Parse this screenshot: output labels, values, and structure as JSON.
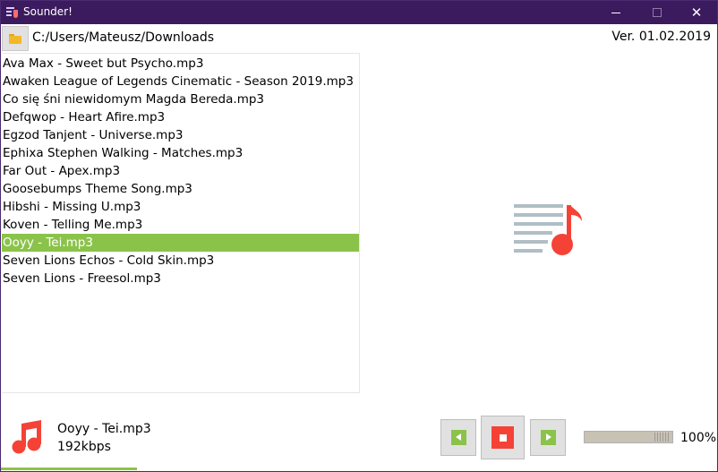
{
  "window": {
    "title": "Sounder!"
  },
  "toolbar": {
    "path": "C:/Users/Mateusz/Downloads",
    "version": "Ver. 01.02.2019"
  },
  "files": [
    "Ava Max - Sweet but Psycho.mp3",
    "Awaken  League of Legends Cinematic - Season 2019.mp3",
    "Co się śni niewidomym Magda Bereda.mp3",
    "Defqwop - Heart Afire.mp3",
    "Egzod  Tanjent - Universe.mp3",
    "Ephixa  Stephen Walking - Matches.mp3",
    "Far Out - Apex.mp3",
    "Goosebumps Theme Song.mp3",
    "Hibshi - Missing U.mp3",
    "Koven - Telling Me.mp3",
    "Ooyy - Tei.mp3",
    "Seven Lions  Echos - Cold Skin.mp3",
    "Seven Lions - Freesol.mp3"
  ],
  "selected_index": 10,
  "now_playing": {
    "title": "Ooyy - Tei.mp3",
    "bitrate": "192kbps",
    "progress": 0.38
  },
  "volume": {
    "label": "100%",
    "value": 1.0
  },
  "icons": {
    "folder": "folder-icon",
    "prev": "previous-icon",
    "stop": "stop-icon",
    "next": "next-icon",
    "music": "music-note-icon",
    "playlist": "playlist-music-icon"
  },
  "colors": {
    "titlebar": "#3b1a5e",
    "accent_green": "#8bc34a",
    "accent_red": "#f44336",
    "list_lines": "#b0bec5"
  }
}
